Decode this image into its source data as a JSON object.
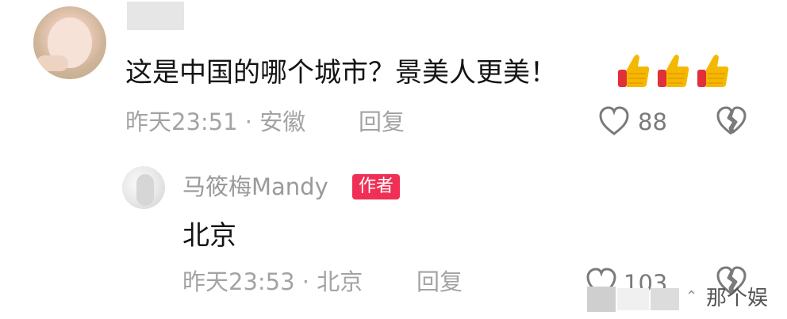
{
  "comment": {
    "text": "这是中国的哪个城市？景美人更美！",
    "meta": "昨天23:51 · 安徽",
    "reply_label": "回复",
    "like_count": "88",
    "reaction_icons": [
      "thumbs-up-icon",
      "thumbs-up-icon",
      "thumbs-up-icon"
    ]
  },
  "reply": {
    "username": "马筱梅Mandy",
    "author_badge": "作者",
    "text": "北京",
    "meta": "昨天23:53 · 北京",
    "reply_label": "回复",
    "like_count": "103"
  },
  "watermark": {
    "text": "那个娱"
  },
  "colors": {
    "badge": "#ef2f55",
    "meta_text": "#a3a3a3",
    "thumb_yellow": "#f5b800",
    "thumb_red": "#e0303a"
  }
}
